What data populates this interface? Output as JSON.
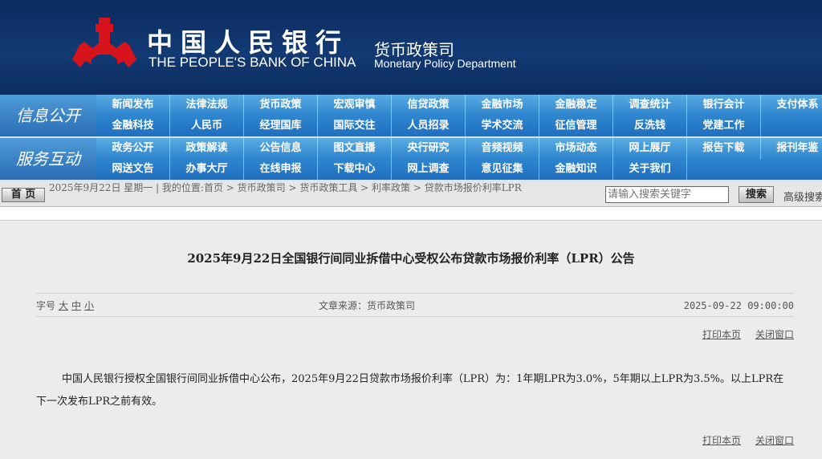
{
  "header": {
    "logo_cn": "中国人民银行",
    "logo_en": "THE PEOPLE'S BANK OF CHINA",
    "dept_cn": "货币政策司",
    "dept_en": "Monetary Policy Department",
    "logo_color": "#d7141c"
  },
  "nav": {
    "band1": {
      "label": "信息公开",
      "row1": [
        "新闻发布",
        "法律法规",
        "货币政策",
        "宏观审慎",
        "信贷政策",
        "金融市场",
        "金融稳定",
        "调查统计",
        "银行会计",
        "支付体系"
      ],
      "row2": [
        "金融科技",
        "人民币",
        "经理国库",
        "国际交往",
        "人员招录",
        "学术交流",
        "征信管理",
        "反洗钱",
        "党建工作"
      ]
    },
    "band2": {
      "label": "服务互动",
      "row1": [
        "政务公开",
        "政策解读",
        "公告信息",
        "图文直播",
        "央行研究",
        "音频视频",
        "市场动态",
        "网上展厅",
        "报告下载",
        "报刊年鉴"
      ],
      "row2": [
        "网送文告",
        "办事大厅",
        "在线申报",
        "下载中心",
        "网上调查",
        "意见征集",
        "金融知识",
        "关于我们"
      ]
    }
  },
  "crumb": {
    "home": "首 页",
    "text": "2025年9月22日 星期一 | 我的位置:首页 > 货币政策司 > 货币政策工具 > 利率政策 > 贷款市场报价利率LPR",
    "search_placeholder": "请输入搜索关键字",
    "search_btn": "搜索",
    "advanced": "高级搜索"
  },
  "article": {
    "title": "2025年9月22日全国银行间同业拆借中心受权公布贷款市场报价利率（LPR）公告",
    "font_label": "字号",
    "font_large": "大",
    "font_medium": "中",
    "font_small": "小",
    "source": "文章来源：货币政策司",
    "datetime": "2025-09-22 09:00:00",
    "print": "打印本页",
    "close": "关闭窗口",
    "body": "中国人民银行授权全国银行间同业拆借中心公布，2025年9月22日贷款市场报价利率（LPR）为：1年期LPR为3.0%，5年期以上LPR为3.5%。以上LPR在下一次发布LPR之前有效。"
  }
}
